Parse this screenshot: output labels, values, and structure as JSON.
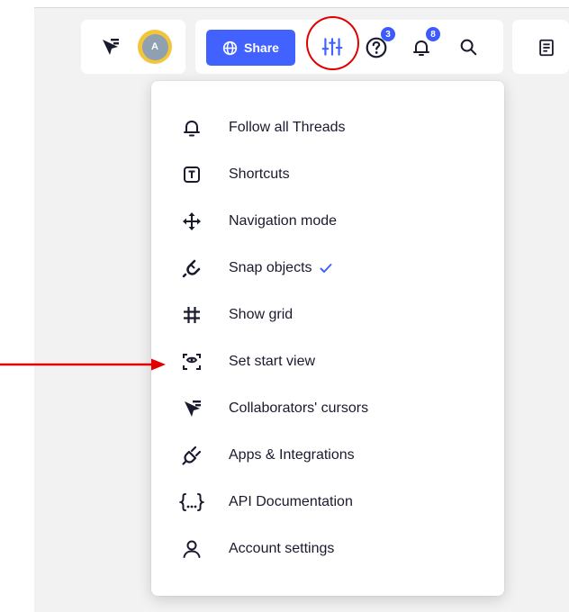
{
  "toolbar": {
    "avatar_initial": "A",
    "share_label": "Share",
    "help_badge": "3",
    "notifications_badge": "8"
  },
  "menu": {
    "items": [
      {
        "label": "Follow all Threads",
        "icon": "bell-icon"
      },
      {
        "label": "Shortcuts",
        "icon": "shortcuts-icon"
      },
      {
        "label": "Navigation mode",
        "icon": "move-arrows-icon"
      },
      {
        "label": "Snap objects",
        "icon": "magnet-icon",
        "checked": true
      },
      {
        "label": "Show grid",
        "icon": "grid-icon"
      },
      {
        "label": "Set start view",
        "icon": "start-view-icon"
      },
      {
        "label": "Collaborators' cursors",
        "icon": "collaborator-cursor-icon"
      },
      {
        "label": "Apps & Integrations",
        "icon": "plug-icon"
      },
      {
        "label": "API Documentation",
        "icon": "braces-icon"
      },
      {
        "label": "Account settings",
        "icon": "user-icon"
      }
    ]
  },
  "colors": {
    "accent": "#4262ff",
    "annotation": "#e00000",
    "avatar_ring": "#f2c53d"
  }
}
